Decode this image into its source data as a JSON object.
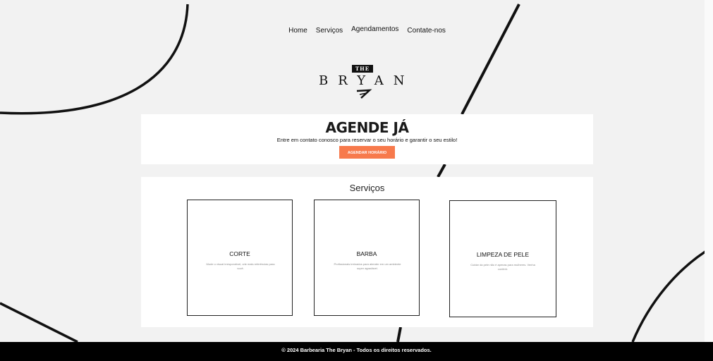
{
  "nav": {
    "items": [
      "Home",
      "Serviços",
      "Agendamentos",
      "Contate-nos"
    ]
  },
  "logo": {
    "the": "THE",
    "name": "BRYAN"
  },
  "hero": {
    "title": "AGENDE JÁ",
    "subtitle": "Entre em contato conosco para reservar o seu horário e garantir o seu estilo!",
    "cta": "AGENDAR HORÁRIO"
  },
  "services": {
    "title": "Serviços",
    "cards": [
      {
        "title": "CORTE",
        "desc": "Mude o visual irrespondível, crie mais referências para você."
      },
      {
        "title": "BARBA",
        "desc": "Profissionais treinados para atender em um ambiente super agradável."
      },
      {
        "title": "LIMPEZA DE PELE",
        "desc": "Cuidar da pele não é apenas para mulheres. Venha conferir."
      }
    ]
  },
  "footer": {
    "text": "© 2024 Barbearia The Bryan - Todos os direitos reservados."
  },
  "colors": {
    "background": "#f2f2f2",
    "accent": "#f77a4c",
    "footer": "#000000"
  }
}
